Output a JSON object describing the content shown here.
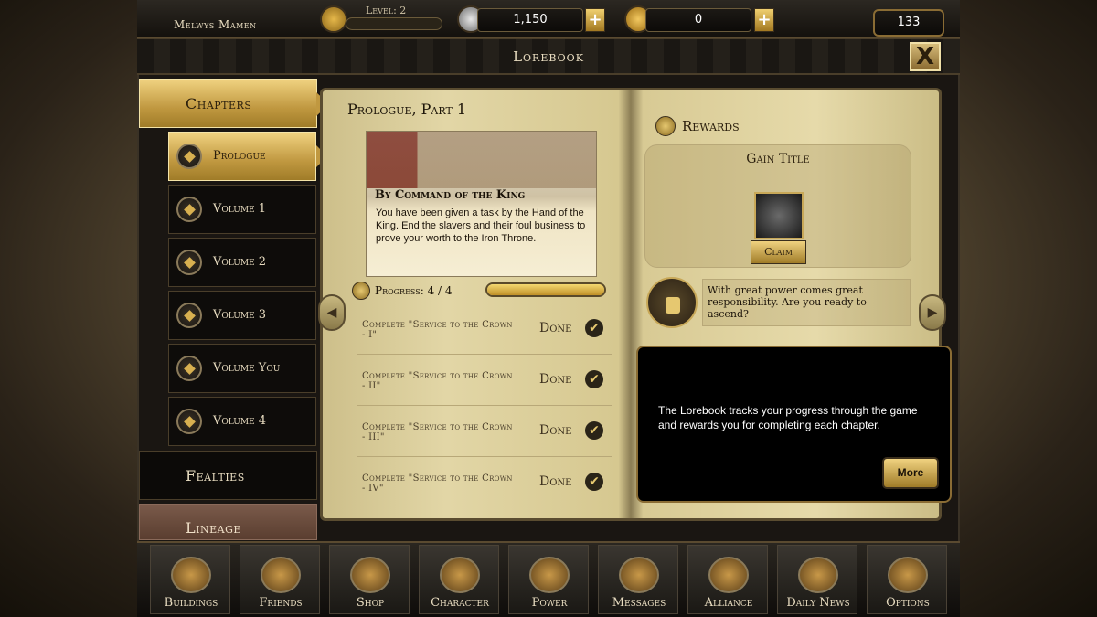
{
  "topbar": {
    "player_name": "Melwys Mamen",
    "level_label": "Level: 2",
    "silver": "1,150",
    "gold": "0",
    "counter": "133",
    "plus": "+"
  },
  "header": {
    "title": "Lorebook",
    "close": "X"
  },
  "sidebar": {
    "chapters_label": "Chapters",
    "volumes": [
      "Prologue",
      "Volume 1",
      "Volume 2",
      "Volume 3",
      "Volume You",
      "Volume 4"
    ],
    "fealties_label": "Fealties",
    "lineage_label": "Lineage"
  },
  "left_page": {
    "title": "Prologue, Part 1",
    "story_title": "By Command of the King",
    "story_text": "You have been given a task by the Hand of the King. End the slavers and their foul business to prove your worth to the Iron Throne.",
    "progress_label": "Progress: 4 / 4",
    "progress_value": 1.0,
    "tasks": [
      {
        "text": "Complete \"Service to the Crown - I\"",
        "status": "Done"
      },
      {
        "text": "Complete \"Service to the Crown - II\"",
        "status": "Done"
      },
      {
        "text": "Complete \"Service to the Crown - III\"",
        "status": "Done"
      },
      {
        "text": "Complete \"Service to the Crown - IV\"",
        "status": "Done"
      }
    ],
    "check_glyph": "✔"
  },
  "right_page": {
    "rewards_label": "Rewards",
    "gain_title": "Gain Title",
    "claim_label": "Claim",
    "quote": "With great power comes great responsibility. Are you ready to ascend?"
  },
  "nav_arrows": {
    "left": "◀",
    "right": "▶"
  },
  "tooltip": {
    "text": "The Lorebook tracks your progress through the game and rewards you for completing each chapter.",
    "more_label": "More"
  },
  "bottom_nav": [
    "Buildings",
    "Friends",
    "Shop",
    "Character",
    "Power",
    "Messages",
    "Alliance",
    "Daily News",
    "Options"
  ],
  "colors": {
    "gold_accent": "#c09840",
    "parchment": "#e2d6a6",
    "dark_panel": "#0e0c0a"
  }
}
